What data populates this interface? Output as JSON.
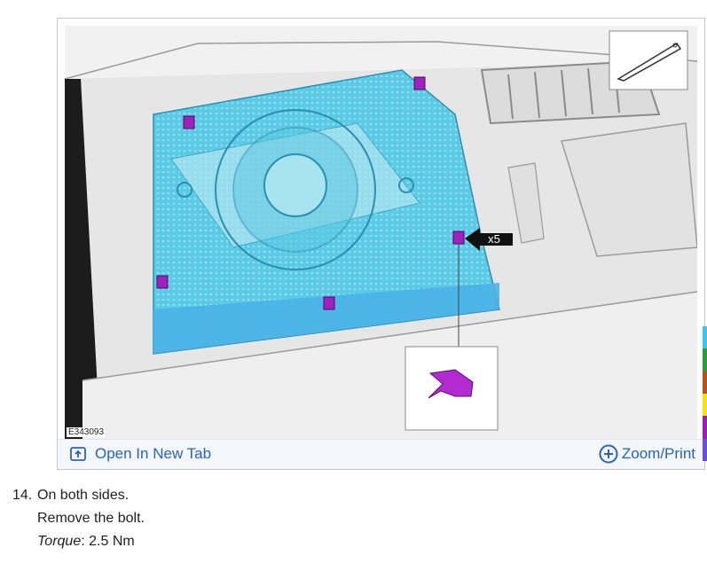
{
  "figure": {
    "id_label": "E343093",
    "callout_label": "x5"
  },
  "toolbar": {
    "open_tab_label": "Open In New Tab",
    "open_tab_icon": "open-in-new-tab-icon",
    "zoom_label": "Zoom/Print",
    "zoom_icon": "plus-circle-icon"
  },
  "colors": {
    "link": "#2a64b8",
    "highlight": "#3fc6e6",
    "clip": "#a020c0",
    "strip": [
      "#3fc6e6",
      "#2e9a3a",
      "#b3521c",
      "#f2e21a",
      "#9b1fb5",
      "#6a4fd2"
    ]
  },
  "step": {
    "number": "14.",
    "line1": "On both sides.",
    "line2": "Remove the bolt.",
    "torque_label": "Torque",
    "torque_sep": ":",
    "torque_value": " 2.5 Nm"
  }
}
